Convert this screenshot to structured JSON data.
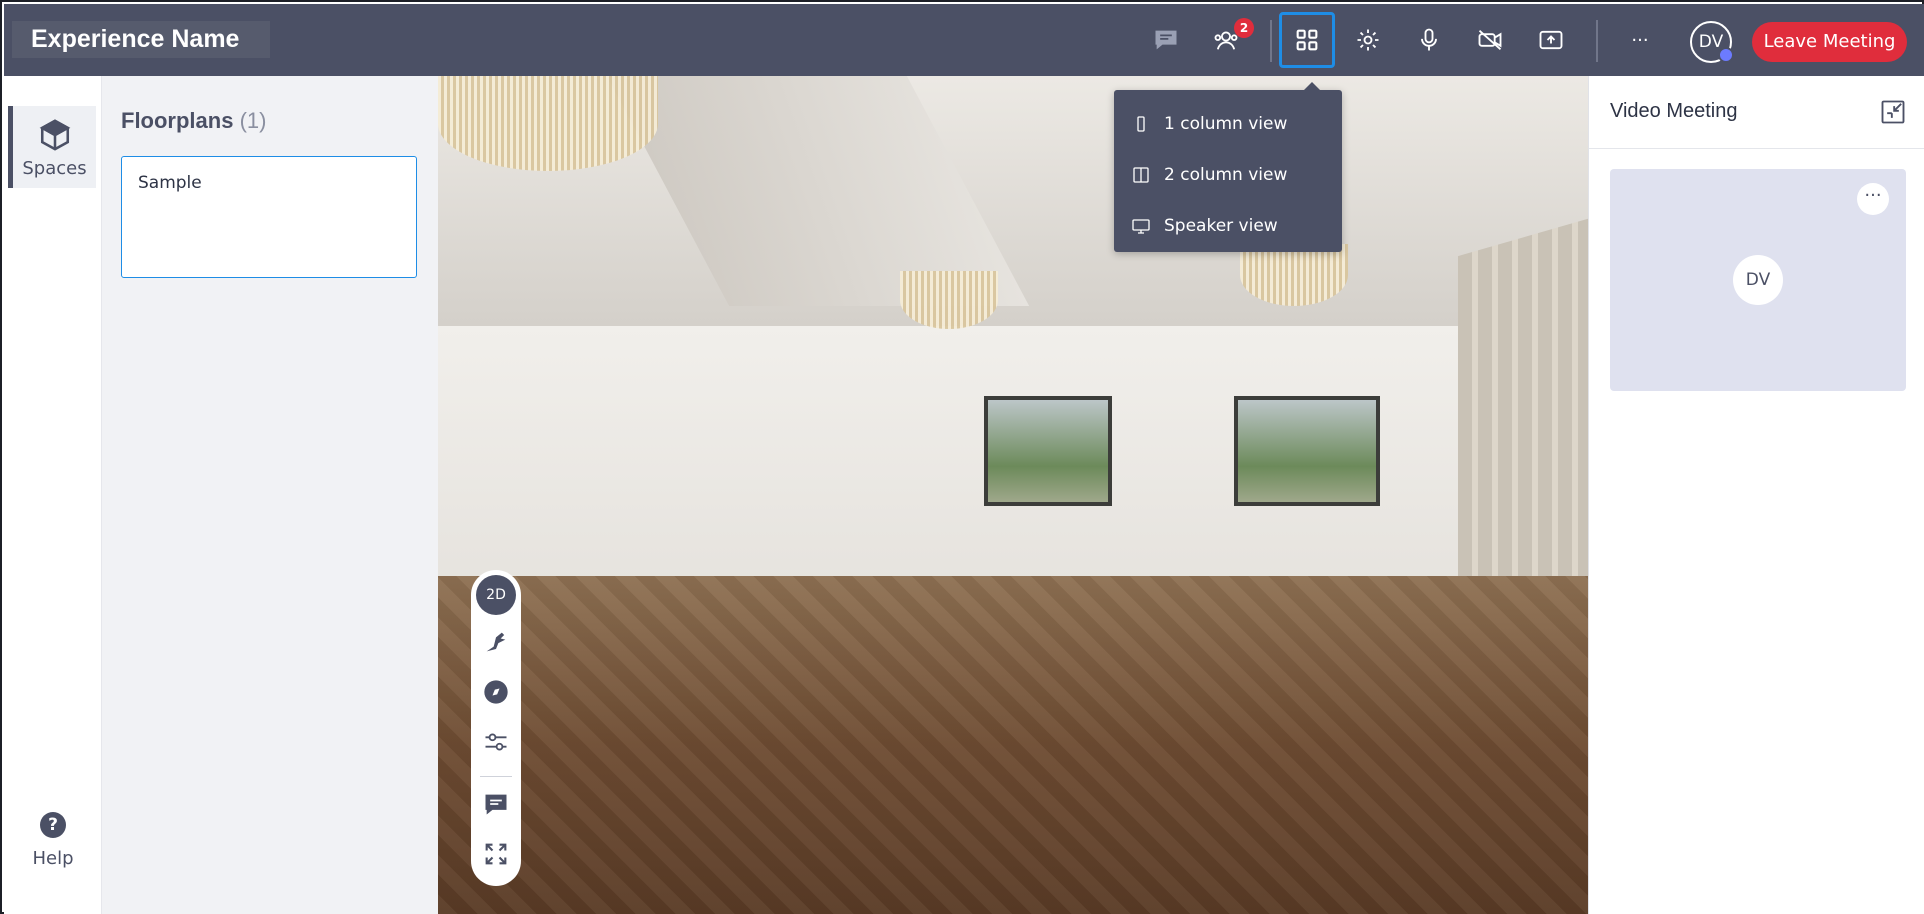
{
  "header": {
    "experience_name": "Experience Name",
    "participants_badge": "2",
    "avatar_initials": "DV",
    "leave_label": "Leave Meeting",
    "more_label": "···",
    "icons": [
      "chat-icon",
      "participants-icon",
      "layout-grid-icon",
      "settings-icon",
      "microphone-icon",
      "camera-off-icon",
      "share-screen-icon",
      "more-icon"
    ]
  },
  "layout_menu": {
    "items": [
      {
        "label": "1 column view",
        "icon": "one-column-icon"
      },
      {
        "label": "2 column view",
        "icon": "two-column-icon"
      },
      {
        "label": "Speaker view",
        "icon": "speaker-view-icon"
      }
    ]
  },
  "rail": {
    "spaces_label": "Spaces",
    "help_label": "Help",
    "help_glyph": "?"
  },
  "floorplans": {
    "title": "Floorplans",
    "count": "(1)",
    "items": [
      {
        "name": "Sample"
      }
    ]
  },
  "viewer_tools": {
    "mode_label": "2D",
    "icons": [
      "dollhouse-icon",
      "compass-icon",
      "adjustments-icon",
      "comment-icon",
      "fullscreen-icon"
    ]
  },
  "video_meeting": {
    "title": "Video Meeting",
    "tile_more": "···",
    "participant_initials": "DV"
  },
  "colors": {
    "topbar": "#4b5065",
    "accent_blue": "#1e8de6",
    "leave_red": "#e02d3c",
    "tile_bg": "#dfe1ef"
  }
}
